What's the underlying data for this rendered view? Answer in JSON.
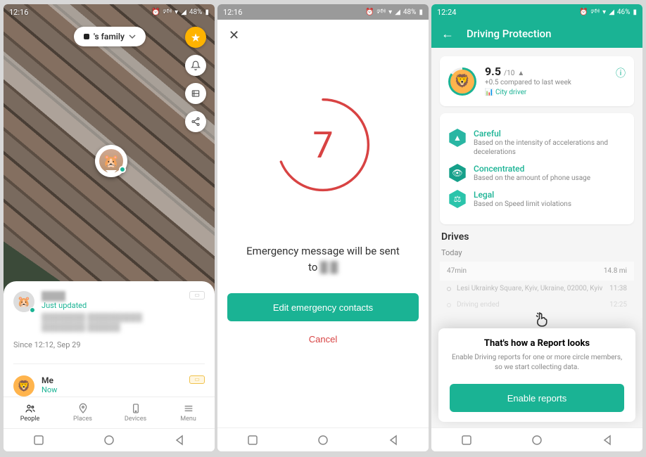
{
  "screen1": {
    "status": {
      "time": "12:16",
      "battery": "48%"
    },
    "family_chip": "'s family",
    "map_buttons": {
      "star": "★",
      "bell": "🔔",
      "layers": "🗺",
      "share": "share"
    },
    "list": [
      {
        "name": "████",
        "sub": "Just updated",
        "addr": "████████ ██████████ ████████ ██████"
      },
      {
        "name": "Me",
        "sub": "Now"
      }
    ],
    "since": "Since 12:12, Sep 29",
    "tabs": [
      "People",
      "Places",
      "Devices",
      "Menu"
    ]
  },
  "screen2": {
    "status": {
      "time": "12:16",
      "battery": "48%"
    },
    "countdown": "7",
    "msg_line1": "Emergency message will be sent",
    "msg_line2_prefix": "to",
    "msg_line2_blur": "█  █",
    "btn_primary": "Edit emergency contacts",
    "btn_cancel": "Cancel"
  },
  "screen3": {
    "status": {
      "time": "12:24",
      "battery": "46%"
    },
    "title": "Driving Protection",
    "score": {
      "value": "9.5",
      "of": "/10",
      "delta": "+0.5 compared to last week",
      "tag": "City driver"
    },
    "traits": [
      {
        "title": "Careful",
        "desc": "Based on the intensity of accelerations and decelerations"
      },
      {
        "title": "Concentrated",
        "desc": "Based on the amount of phone usage"
      },
      {
        "title": "Legal",
        "desc": "Based on Speed limit violations"
      }
    ],
    "drives_header": "Drives",
    "drives_today": "Today",
    "drive_summary": {
      "duration": "47min",
      "distance": "14.8 mi"
    },
    "route": [
      {
        "place": "Lesi Ukrainky Square, Kyiv, Ukraine, 02000, Kyiv",
        "time": "11:38"
      },
      {
        "place": "Driving ended",
        "time": "12:25"
      }
    ],
    "overlay": {
      "title": "That's how a Report looks",
      "desc": "Enable Driving reports for one or more circle members, so we start collecting data.",
      "btn": "Enable reports"
    }
  }
}
